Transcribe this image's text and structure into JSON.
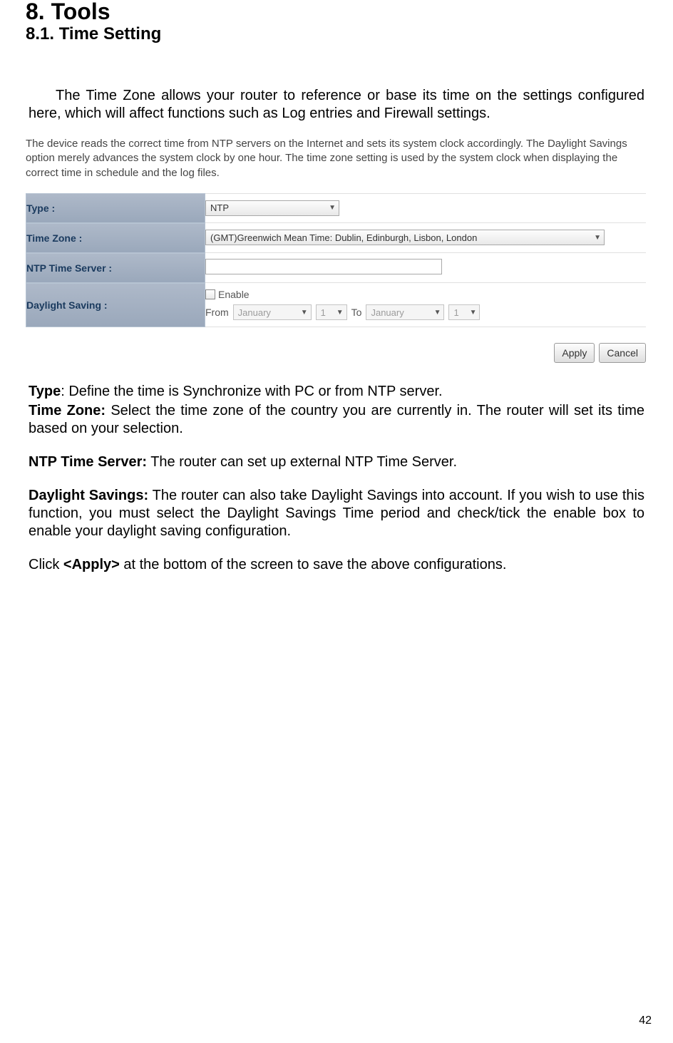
{
  "heading": {
    "main": "8. Tools",
    "sub": "8.1. Time Setting"
  },
  "intro": "The Time Zone allows your router to reference or base its time on the settings configured here, which will affect functions such as Log entries and Firewall settings.",
  "screenshot": {
    "description": "The device reads the correct time from NTP servers on the Internet and sets its system clock accordingly. The Daylight Savings option merely advances the system clock by one hour. The time zone setting is used by the system clock when displaying the correct time in schedule and the log files.",
    "rows": {
      "type": {
        "label": "Type :",
        "value": "NTP"
      },
      "timezone": {
        "label": "Time Zone :",
        "value": "(GMT)Greenwich Mean Time: Dublin, Edinburgh, Lisbon, London"
      },
      "ntp": {
        "label": "NTP Time Server :",
        "value": ""
      },
      "daylight": {
        "label": "Daylight Saving :",
        "enable_label": "Enable",
        "from_label": "From",
        "to_label": "To",
        "from_month": "January",
        "from_day": "1",
        "to_month": "January",
        "to_day": "1"
      }
    },
    "buttons": {
      "apply": "Apply",
      "cancel": "Cancel"
    }
  },
  "definitions": {
    "type": {
      "label": "Type",
      "text": ": Define the time is Synchronize with PC or from NTP server."
    },
    "timezone": {
      "label": "Time Zone:",
      "text": " Select the time zone of the country you are currently in. The router will set its time based on your selection."
    },
    "ntp": {
      "label": "NTP Time Server:",
      "text": " The router can set up external NTP Time Server."
    },
    "daylight": {
      "label": "Daylight Savings:",
      "text": " The router can also take Daylight Savings into account. If you wish to use this function, you must select the Daylight Savings Time period and check/tick the enable box to enable your daylight saving configuration."
    },
    "click": {
      "pre": "Click ",
      "bold": "<Apply>",
      "post": " at the bottom of the screen to save the above configurations."
    }
  },
  "page_number": "42"
}
